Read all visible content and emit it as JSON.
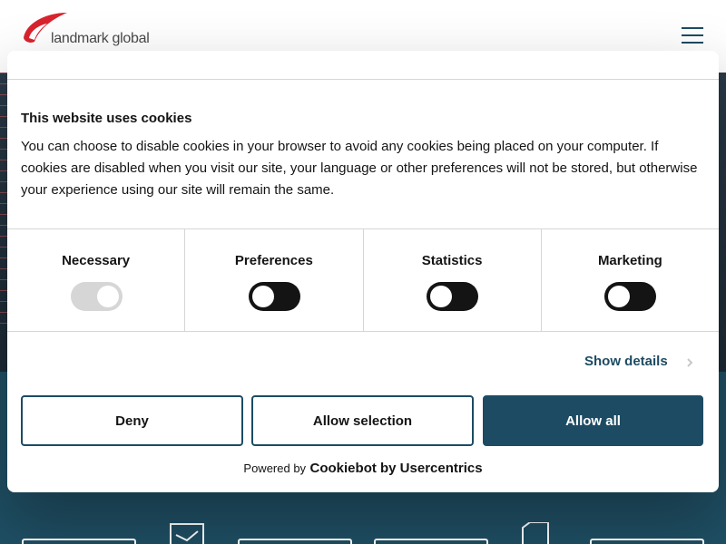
{
  "header": {
    "logo_text": "landmark global",
    "menu_icon": "hamburger-menu-icon"
  },
  "cookie_dialog": {
    "title": "This website uses cookies",
    "description": "You can choose to disable cookies in your browser to avoid any cookies being placed on your computer. If cookies are disabled when you visit our site, your language or other preferences will not be stored, but otherwise your experience using our site will remain the same.",
    "categories": [
      {
        "label": "Necessary",
        "enabled": true,
        "locked": true
      },
      {
        "label": "Preferences",
        "enabled": false,
        "locked": false
      },
      {
        "label": "Statistics",
        "enabled": false,
        "locked": false
      },
      {
        "label": "Marketing",
        "enabled": false,
        "locked": false
      }
    ],
    "show_details": "Show details",
    "buttons": {
      "deny": "Deny",
      "allow_selection": "Allow selection",
      "allow_all": "Allow all"
    },
    "powered_by": "Powered by",
    "powered_brand": "Cookiebot by Usercentrics"
  },
  "colors": {
    "brand_primary": "#1d4b63",
    "logo_red": "#d9232e",
    "toggle_off": "#141414",
    "toggle_disabled": "#d6d6d6"
  }
}
